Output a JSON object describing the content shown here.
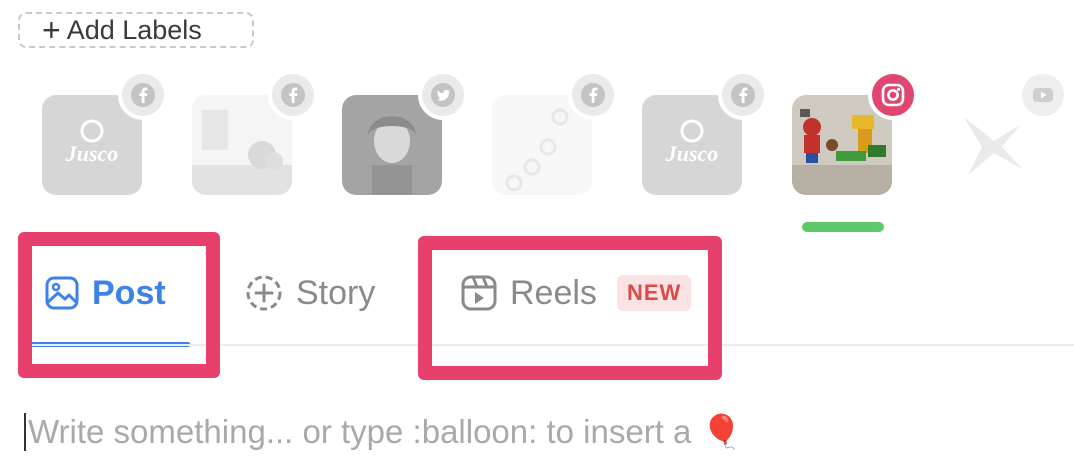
{
  "labels": {
    "add_label": "Add Labels",
    "add_icon": "plus-icon"
  },
  "accounts": [
    {
      "name": "Jusco",
      "network": "facebook",
      "selected": false,
      "avatar_text": "Jusco"
    },
    {
      "name": "Room interior",
      "network": "facebook",
      "selected": false
    },
    {
      "name": "Portrait",
      "network": "twitter",
      "selected": false
    },
    {
      "name": "Pattern",
      "network": "facebook",
      "selected": false
    },
    {
      "name": "Jusco",
      "network": "facebook",
      "selected": false,
      "avatar_text": "Jusco"
    },
    {
      "name": "Toy scene",
      "network": "instagram",
      "selected": true
    },
    {
      "name": "Brand",
      "network": "youtube",
      "selected": false
    }
  ],
  "colors": {
    "selected_indicator": "#5cc96a",
    "active_tab": "#3d82e8",
    "highlight": "#e8406d",
    "instagram_badge": "#e0466e"
  },
  "tabs": {
    "post": {
      "label": "Post",
      "icon": "image-icon",
      "active": true
    },
    "story": {
      "label": "Story",
      "icon": "circle-plus-icon"
    },
    "reels": {
      "label": "Reels",
      "icon": "reels-icon",
      "badge": "NEW"
    }
  },
  "composer": {
    "placeholder": "Write something... or type :balloon: to insert a",
    "emoji": "🎈"
  }
}
